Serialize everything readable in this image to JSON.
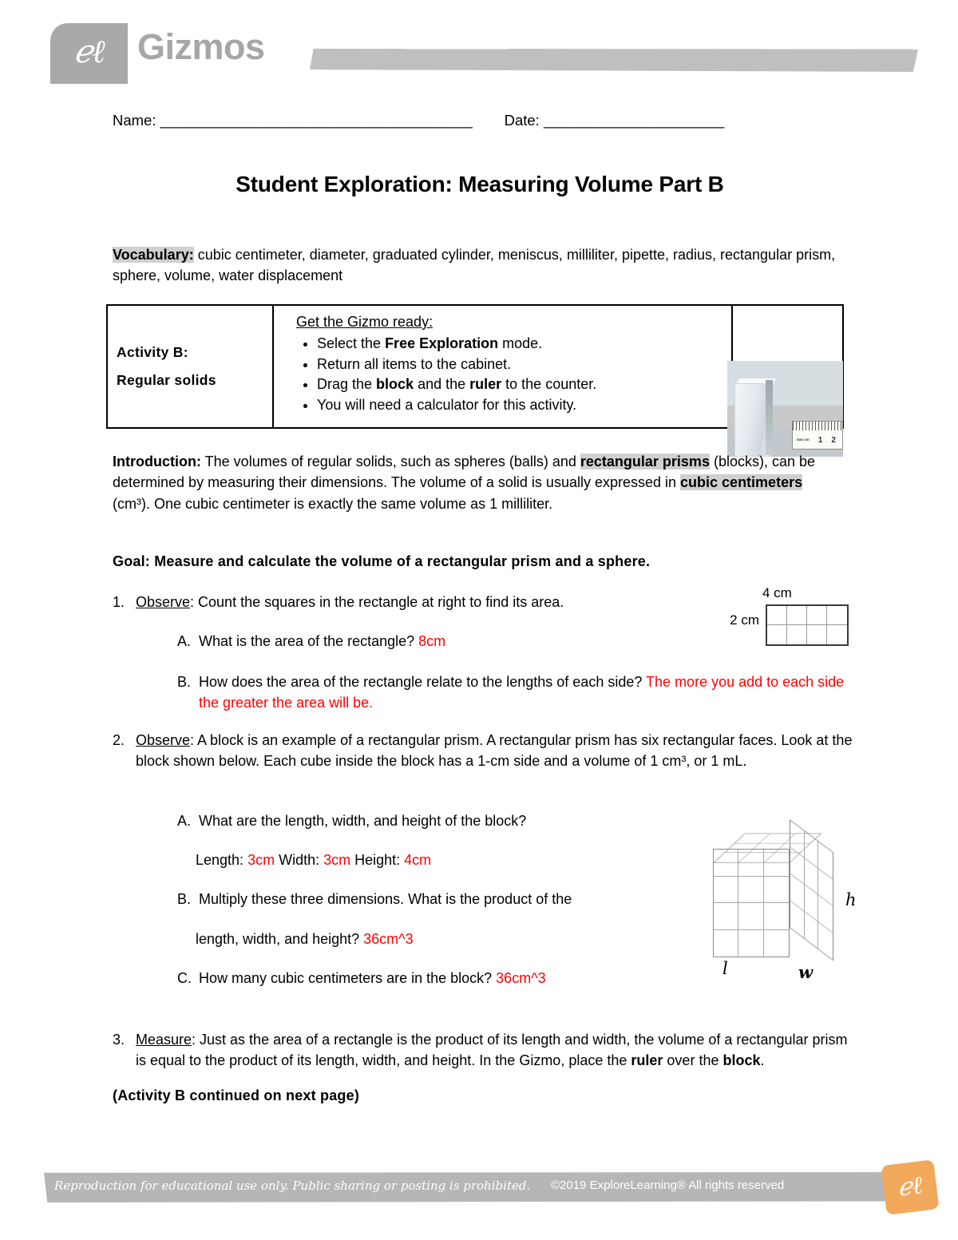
{
  "header": {
    "logo_icon": "gizmos-el-logo-icon",
    "logo_mark": "ℯℓ",
    "brand": "Gizmos",
    "bar_color": "#bfbfbf"
  },
  "nameline": {
    "name_label": "Name: ______________________________________",
    "date_label": "Date: ______________________"
  },
  "title": "Student Exploration: Measuring Volume Part B",
  "vocabulary": {
    "label": "Vocabulary:",
    "terms": " cubic centimeter, diameter, graduated cylinder, meniscus, milliliter, pipette, radius, rectangular prism, sphere, volume, water displacement"
  },
  "activity": {
    "name": "Activity B:",
    "subtitle": "Regular solids",
    "heading": "Get the Gizmo ready:",
    "steps": [
      "Select the Free Exploration mode.",
      "Return all items to the cabinet.",
      "Drag the block and the ruler to the counter.",
      "You will need a calculator for this activity."
    ],
    "photo_alt": "block-and-ruler-photo",
    "ruler_marks": [
      "1",
      "2"
    ],
    "ruler_unit": "mm cm"
  },
  "introduction": {
    "label": "Introduction:",
    "text_1": " The volumes of regular solids, such as spheres (balls) and ",
    "term_1": "rectangular prisms",
    "text_2": " (blocks), can be determined by measuring their dimensions. The volume of a solid is usually expressed in ",
    "term_2": "cubic centimeters",
    "text_3": " (cm³). One cubic centimeter is exactly the same volume as 1 milliliter."
  },
  "goal": "Goal: Measure and calculate the volume of a rectangular prism and a sphere.",
  "questions": {
    "q1": {
      "number": "1.",
      "verb": "Observe",
      "text": ": Count the squares in the rectangle at right to find its area.",
      "a": {
        "letter": "A.",
        "text": "What is the area of the rectangle? ",
        "answer": "8cm"
      },
      "b": {
        "letter": "B.",
        "text": "How does the area of the rectangle relate to the lengths of each side? ",
        "answer": "The more you add to each side the greater the area will be."
      }
    },
    "q2": {
      "number": "2.",
      "verb": "Observe",
      "text": ": A block is an example of a rectangular prism. A rectangular prism has six rectangular faces. Look at the block shown below. Each cube inside the block has a 1-cm side and a volume of 1 cm³, or 1 mL.",
      "a": {
        "letter": "A.",
        "text": "What are the length, width, and height of the block?",
        "length_label": "Length: ",
        "length": "3cm",
        "width_label": " Width: ",
        "width": "3cm",
        "height_label": " Height: ",
        "height": "4cm"
      },
      "b": {
        "letter": "B.",
        "text": "Multiply these three dimensions. What is the product of the",
        "text2": "length, width, and height? ",
        "answer": "36cm^3"
      },
      "c": {
        "letter": "C.",
        "text": "How many cubic centimeters are in the block? ",
        "answer": "36cm^3"
      }
    },
    "q3": {
      "number": "3.",
      "verb": "Measure",
      "text": ": Just as the area of a rectangle is the product of its length and width, the volume of a rectangular prism is equal to the product of its length, width, and height. In the Gizmo, place the ",
      "bold_1": "ruler",
      "text_mid": " over the ",
      "bold_2": "block",
      "text_end": "."
    },
    "continued": "(Activity B continued on next page)"
  },
  "figures": {
    "rectangle": {
      "name": "rectangle-area-diagram",
      "top_label": "4 cm",
      "left_label": "2 cm",
      "cols": 4,
      "rows": 2
    },
    "block": {
      "name": "rectangular-prism-diagram",
      "label_h": "h",
      "label_l": "l",
      "label_w": "w",
      "length": 3,
      "width": 3,
      "height": 4
    }
  },
  "footer": {
    "left": "Reproduction for educational use only. Public sharing or posting is prohibited.",
    "right": "©2019 ExploreLearning®  All rights reserved",
    "logo_mark": "ℯℓ",
    "logo_color": "#f2a95c"
  }
}
